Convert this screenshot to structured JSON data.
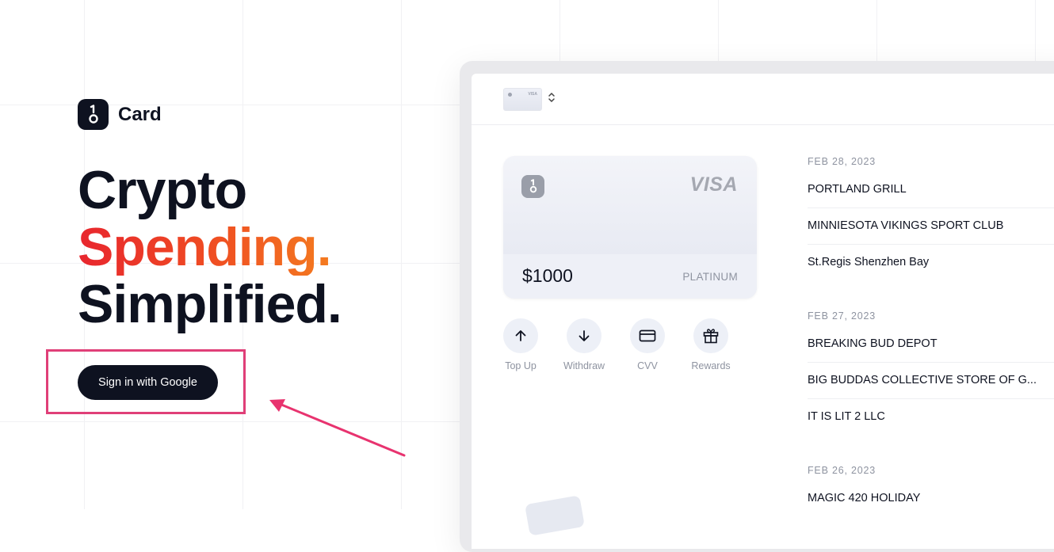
{
  "brand": {
    "name": "Card",
    "logo_icon": "one-dot-logo-icon"
  },
  "hero": {
    "line1": "Crypto",
    "line2": "Spending.",
    "line3": "Simplified."
  },
  "cta": {
    "google_label": "Sign in with Google",
    "highlight_color": "#e03f78"
  },
  "colors": {
    "dark": "#0e1220",
    "gradient_start": "#e8262e",
    "gradient_end": "#f47b20"
  },
  "app": {
    "card_selector": {
      "mini_visa": "VISA",
      "icon": "chevron-up-down-icon"
    },
    "card": {
      "brand": "VISA",
      "balance": "$1000",
      "tier": "PLATINUM"
    },
    "actions": [
      {
        "label": "Top Up",
        "icon": "arrow-up-icon"
      },
      {
        "label": "Withdraw",
        "icon": "arrow-down-icon"
      },
      {
        "label": "CVV",
        "icon": "credit-card-icon"
      },
      {
        "label": "Rewards",
        "icon": "gift-icon"
      }
    ],
    "transactions": [
      {
        "date": "FEB 28, 2023",
        "items": [
          "PORTLAND GRILL",
          "MINNIESOTA VIKINGS SPORT CLUB",
          "St.Regis Shenzhen Bay"
        ]
      },
      {
        "date": "FEB 27, 2023",
        "items": [
          "BREAKING BUD DEPOT",
          "BIG BUDDAS COLLECTIVE STORE OF G...",
          "IT IS LIT 2 LLC"
        ]
      },
      {
        "date": "FEB 26, 2023",
        "items": [
          "MAGIC 420 HOLIDAY"
        ]
      }
    ]
  }
}
